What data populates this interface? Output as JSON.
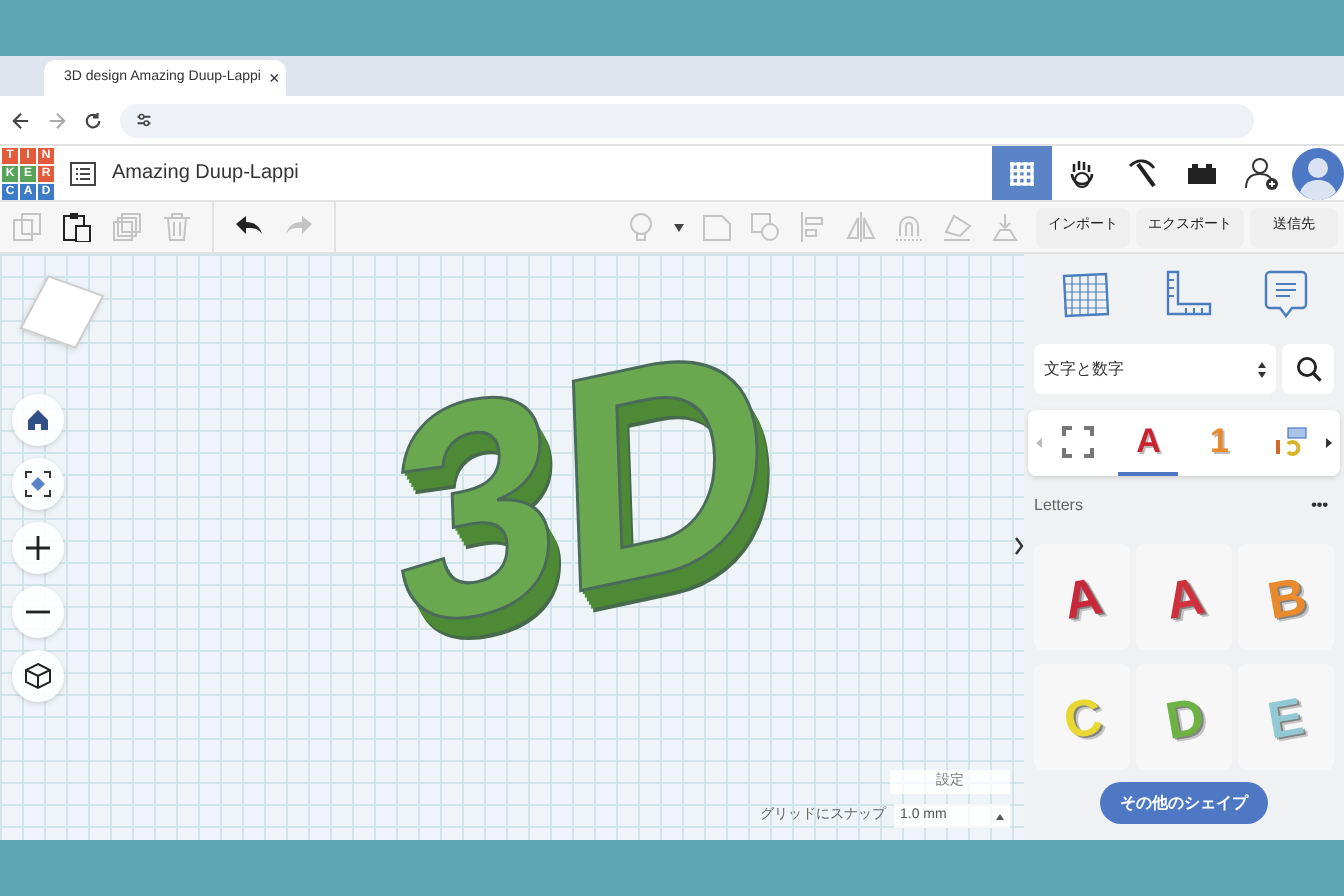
{
  "browser": {
    "tab": {
      "title": "3D design Amazing Duup-Lappi",
      "close": "×"
    }
  },
  "app": {
    "logo": [
      "T",
      "I",
      "N",
      "K",
      "E",
      "R",
      "C",
      "A",
      "D"
    ],
    "title": "Amazing Duup-Lappi",
    "modes": [
      {
        "kind": "grid",
        "selected": true
      },
      {
        "kind": "hand",
        "selected": false
      },
      {
        "kind": "pickaxe",
        "selected": false
      },
      {
        "kind": "brick",
        "selected": false
      }
    ]
  },
  "toolbar": {
    "actions": [
      {
        "kind": "copy",
        "disabled": true
      },
      {
        "kind": "paste",
        "disabled": false
      },
      {
        "kind": "duplicate",
        "disabled": true
      },
      {
        "kind": "delete",
        "disabled": true
      },
      {
        "kind": "undo",
        "disabled": false
      },
      {
        "kind": "redo",
        "disabled": true
      }
    ],
    "tools": [
      {
        "kind": "bulb",
        "disabled": true
      },
      {
        "kind": "note",
        "disabled": true
      },
      {
        "kind": "group",
        "disabled": true
      },
      {
        "kind": "align",
        "disabled": true
      },
      {
        "kind": "mirror",
        "disabled": true
      },
      {
        "kind": "magnet",
        "disabled": true
      },
      {
        "kind": "cruise",
        "disabled": true
      },
      {
        "kind": "drop",
        "disabled": true
      }
    ],
    "buttons": [
      "インポート",
      "エクスポート",
      "送信先"
    ]
  },
  "canvas": {
    "model": {
      "text": "3D"
    },
    "settings": "設定",
    "snap_label": "グリッドにスナップ",
    "snap_value": "1.0 mm"
  },
  "panel": {
    "category": "文字と数字",
    "category_tabs": [
      {
        "kind": "frame",
        "selected": false
      },
      {
        "kind": "glyph",
        "glyph": "A",
        "color": "#c8232f",
        "selected": true
      },
      {
        "kind": "glyph",
        "glyph": "1",
        "color": "#e8892c",
        "selected": false
      },
      {
        "kind": "connector",
        "selected": false
      }
    ],
    "section": "Letters",
    "more": "•••",
    "shapes": [
      {
        "glyph": "A",
        "color": "#c8283a"
      },
      {
        "glyph": "A",
        "color": "#d0303c"
      },
      {
        "glyph": "B",
        "color": "#e98a2c"
      },
      {
        "glyph": "C",
        "color": "#e9d834"
      },
      {
        "glyph": "D",
        "color": "#6db344"
      },
      {
        "glyph": "E",
        "color": "#93c9d4"
      }
    ],
    "more_button": "その他のシェイプ"
  }
}
